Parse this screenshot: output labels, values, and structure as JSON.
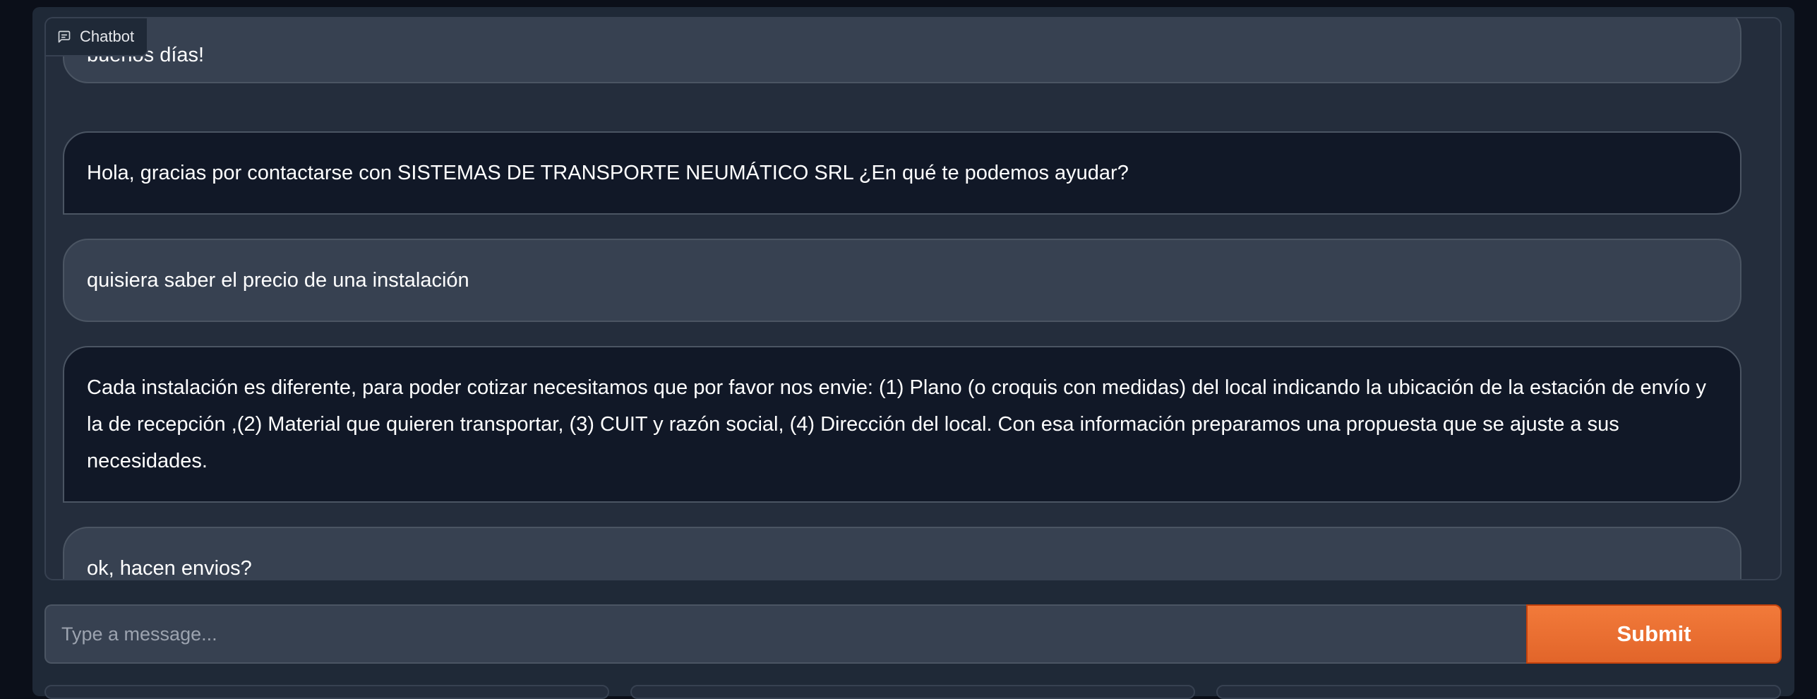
{
  "chatbot": {
    "label": "Chatbot",
    "icon": "chat-icon"
  },
  "messages": [
    {
      "role": "user",
      "text": "buenos días!"
    },
    {
      "role": "bot",
      "text": "Hola, gracias por contactarse con SISTEMAS DE TRANSPORTE NEUMÁTICO SRL ¿En qué te podemos ayudar?"
    },
    {
      "role": "user",
      "text": "quisiera saber el precio de una instalación"
    },
    {
      "role": "bot",
      "text": "Cada instalación es diferente, para poder cotizar necesitamos que por favor nos envie: (1) Plano (o croquis con medidas) del local indicando la ubicación de la estación de envío y la de recepción ,(2) Material que quieren transportar, (3) CUIT y razón social, (4) Dirección del local. Con esa información preparamos una propuesta que se ajuste a sus necesidades."
    },
    {
      "role": "user",
      "text": "ok, hacen envios?"
    }
  ],
  "composer": {
    "placeholder": "Type a message...",
    "submit_label": "Submit"
  },
  "colors": {
    "accent": "#e8672c",
    "user_bubble": "#374151",
    "bot_bubble": "#111827",
    "background": "#0b0f19"
  }
}
